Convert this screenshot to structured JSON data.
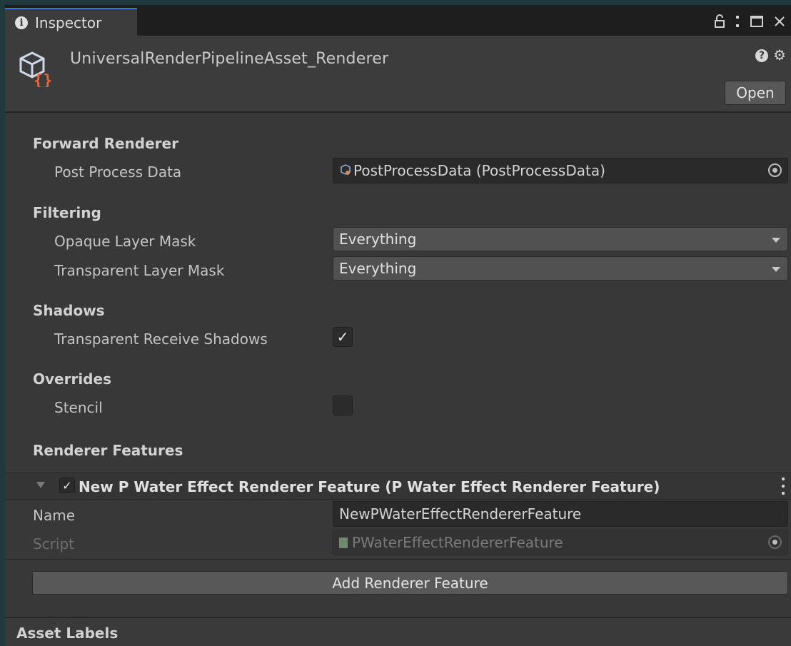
{
  "tab": {
    "label": "Inspector",
    "info_icon": "i"
  },
  "header": {
    "title": "UniversalRenderPipelineAsset_Renderer",
    "open_label": "Open",
    "help_glyph": "?"
  },
  "sections": {
    "forward": {
      "title": "Forward Renderer",
      "post_process_label": "Post Process Data",
      "post_process_value": "PostProcessData (PostProcessData)"
    },
    "filtering": {
      "title": "Filtering",
      "opaque_label": "Opaque Layer Mask",
      "opaque_value": "Everything",
      "transparent_label": "Transparent Layer Mask",
      "transparent_value": "Everything"
    },
    "shadows": {
      "title": "Shadows",
      "receive_label": "Transparent Receive Shadows",
      "receive_checked": true,
      "check_glyph": "✓"
    },
    "overrides": {
      "title": "Overrides",
      "stencil_label": "Stencil",
      "stencil_checked": false
    },
    "features": {
      "title": "Renderer Features",
      "feature_title": "New P Water Effect Renderer Feature (P Water Effect Renderer Feature)",
      "feature_enabled": true,
      "check_glyph": "✓",
      "name_label": "Name",
      "name_value": "NewPWaterEffectRendererFeature",
      "script_label": "Script",
      "script_value": "PWaterEffectRendererFeature",
      "add_label": "Add Renderer Feature"
    }
  },
  "asset_labels": {
    "title": "Asset Labels"
  },
  "colors": {
    "accent_tab": "#3a78c9",
    "asset_icon_brace": "#e8623a",
    "panel": "#383838"
  }
}
